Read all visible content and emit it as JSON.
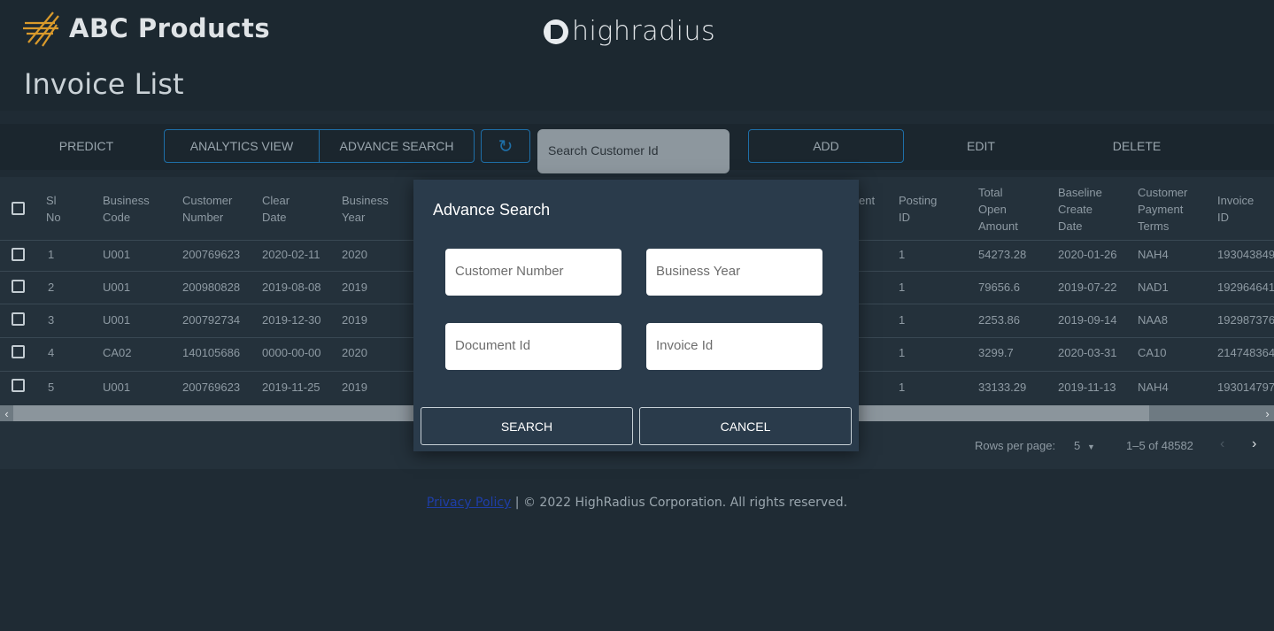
{
  "header": {
    "brand": "ABC Products",
    "partner": "highradius",
    "page_title": "Invoice List"
  },
  "toolbar": {
    "predict": "PREDICT",
    "analytics": "ANALYTICS VIEW",
    "advance_search": "ADVANCE SEARCH",
    "refresh_icon": "refresh-icon",
    "search_placeholder": "Search Customer Id",
    "add": "ADD",
    "edit": "EDIT",
    "delete": "DELETE"
  },
  "table": {
    "columns": [
      {
        "label": "Sl\nNo"
      },
      {
        "label": "Business\nCode"
      },
      {
        "label": "Customer\nNumber"
      },
      {
        "label": "Clear\nDate"
      },
      {
        "label": "Business\nYear"
      },
      {
        "label": "ent"
      },
      {
        "label": "Posting\nID"
      },
      {
        "label": "Total\nOpen\nAmount"
      },
      {
        "label": "Baseline\nCreate\nDate"
      },
      {
        "label": "Customer\nPayment\nTerms"
      },
      {
        "label": "Invoice\nID"
      }
    ],
    "rows": [
      {
        "sl": "1",
        "code": "U001",
        "cust": "200769623",
        "clear": "2020-02-11",
        "year": "2020",
        "posting": "1",
        "amount": "54273.28",
        "baseline": "2020-01-26",
        "terms": "NAH4",
        "invoice": "193043849"
      },
      {
        "sl": "2",
        "code": "U001",
        "cust": "200980828",
        "clear": "2019-08-08",
        "year": "2019",
        "posting": "1",
        "amount": "79656.6",
        "baseline": "2019-07-22",
        "terms": "NAD1",
        "invoice": "192964641"
      },
      {
        "sl": "3",
        "code": "U001",
        "cust": "200792734",
        "clear": "2019-12-30",
        "year": "2019",
        "posting": "1",
        "amount": "2253.86",
        "baseline": "2019-09-14",
        "terms": "NAA8",
        "invoice": "192987376"
      },
      {
        "sl": "4",
        "code": "CA02",
        "cust": "140105686",
        "clear": "0000-00-00",
        "year": "2020",
        "posting": "1",
        "amount": "3299.7",
        "baseline": "2020-03-31",
        "terms": "CA10",
        "invoice": "214748364"
      },
      {
        "sl": "5",
        "code": "U001",
        "cust": "200769623",
        "clear": "2019-11-25",
        "year": "2019",
        "posting": "1",
        "amount": "33133.29",
        "baseline": "2019-11-13",
        "terms": "NAH4",
        "invoice": "193014797"
      }
    ],
    "pagination": {
      "rows_per_page_label": "Rows per page:",
      "rows_per_page": "5",
      "range": "1–5 of 48582"
    }
  },
  "footer": {
    "privacy": "Privacy Policy",
    "copyright": "| © 2022 HighRadius Corporation. All rights reserved."
  },
  "modal": {
    "title": "Advance Search",
    "fields": {
      "customer_number": "Customer Number",
      "business_year": "Business Year",
      "document_id": "Document Id",
      "invoice_id": "Invoice Id"
    },
    "search": "SEARCH",
    "cancel": "CANCEL"
  }
}
